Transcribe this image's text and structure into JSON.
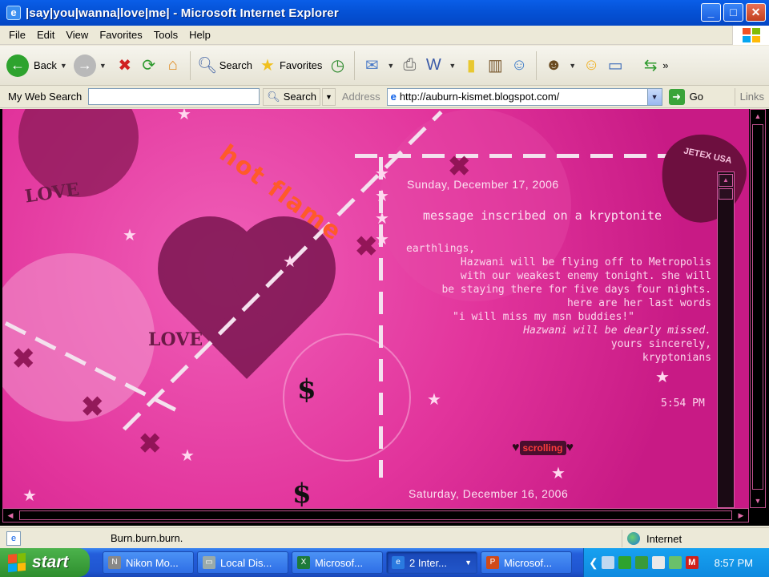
{
  "window": {
    "title": "|say|you|wanna|love|me| - Microsoft Internet Explorer"
  },
  "menu": [
    "File",
    "Edit",
    "View",
    "Favorites",
    "Tools",
    "Help"
  ],
  "toolbar": {
    "back_label": "Back",
    "search_label": "Search",
    "favorites_label": "Favorites"
  },
  "address_bar": {
    "my_web_search_label": "My Web Search",
    "search_button_label": "Search",
    "address_label": "Address",
    "url": "http://auburn-kismet.blogspot.com/",
    "go_label": "Go",
    "links_label": "Links"
  },
  "page": {
    "decor_hot_flame": "hot flame",
    "decor_love_1": "LOVE",
    "decor_love_2": "LOVE",
    "guitar_pick_text": "JETEX USA",
    "badge_text": "scrolling",
    "post": {
      "date": "Sunday, December 17, 2006",
      "title": "message inscribed on a kryptonite",
      "lines": [
        "earthlings,",
        "Hazwani will be flying off to Metropolis",
        "with our weakest enemy tonight. she will",
        "be staying there for five days four nights.",
        "here are her last words",
        "\"i will miss my msn buddies!\"",
        "Hazwani will be dearly missed.",
        "yours sincerely,",
        "kryptonians"
      ],
      "time": "5:54 PM"
    },
    "next_post_date": "Saturday, December 16, 2006"
  },
  "status": {
    "text": "Burn.burn.burn.",
    "zone": "Internet"
  },
  "taskbar": {
    "start_label": "start",
    "tasks": [
      "Nikon Mo...",
      "Local Dis...",
      "Microsof...",
      "2 Inter...",
      "Microsof..."
    ],
    "clock": "8:57 PM"
  },
  "colors": {
    "accent": "#e2349c",
    "xp_blue": "#0a5ee8",
    "post_text": "#fbd7ec"
  }
}
